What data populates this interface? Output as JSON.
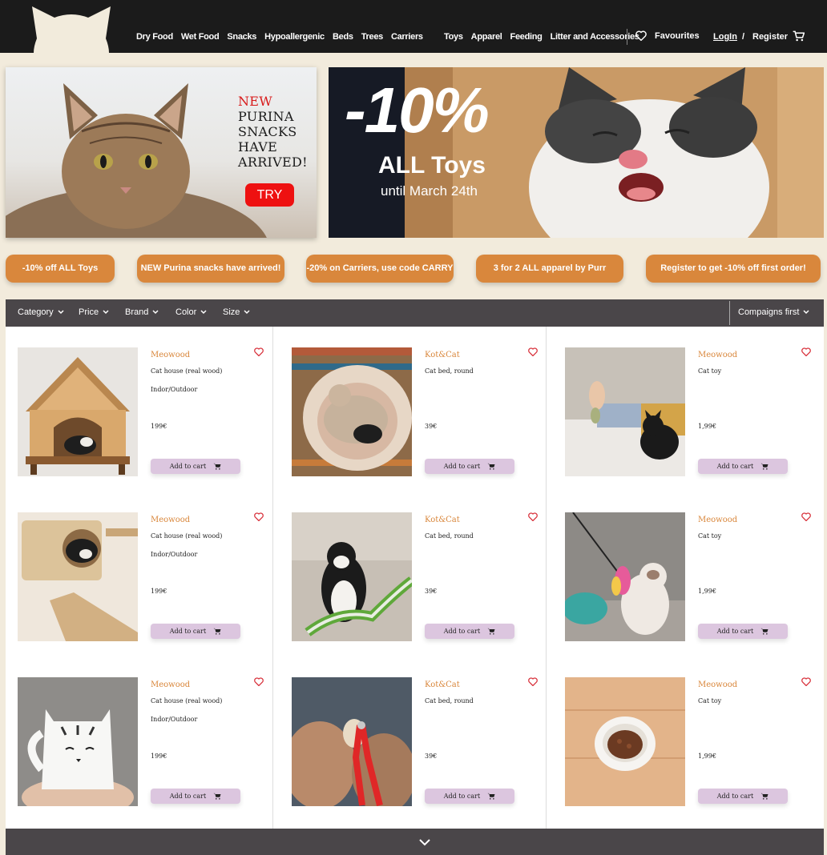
{
  "header": {
    "nav_food": [
      "Dry Food",
      "Wet Food",
      "Snacks",
      "Hypoallergenic"
    ],
    "nav_furniture": [
      "Beds",
      "Trees",
      "Carriers"
    ],
    "nav_other": [
      "Toys",
      "Apparel",
      "Feeding",
      "Litter and Accessories"
    ],
    "favourites_label": "Favourites",
    "login_label": "LogIn",
    "slash": "/",
    "register_label": "Register"
  },
  "banner_left": {
    "line1": "NEW",
    "line2": "PURINA",
    "line3": "SNACKS",
    "line4": "HAVE",
    "line5": "ARRIVED!",
    "button_label": "TRY"
  },
  "banner_right": {
    "discount": "-10%",
    "title": "ALL Toys",
    "subtitle": "until March 24th"
  },
  "promos": [
    "-10% off ALL Toys",
    "NEW Purina snacks have arrived!",
    "-20% on Carriers, use code CARRY",
    "3 for 2 ALL apparel by Purr",
    "Register to get -10% off first order!"
  ],
  "filters": {
    "items": [
      "Category",
      "Price",
      "Brand",
      "Color",
      "Size"
    ],
    "sort_label": "Compaigns first"
  },
  "products": [
    {
      "brand": "Meowood",
      "desc": "Cat house (real wood)",
      "desc2": "Indor/Outdoor",
      "price": "199€",
      "cart_label": "Add to cart"
    },
    {
      "brand": "Kot&Cat",
      "desc": "Cat bed, round",
      "desc2": "",
      "price": "39€",
      "cart_label": "Add to cart"
    },
    {
      "brand": "Meowood",
      "desc": "Cat toy",
      "desc2": "",
      "price": "1,99€",
      "cart_label": "Add to cart"
    },
    {
      "brand": "Meowood",
      "desc": "Cat house (real wood)",
      "desc2": "Indor/Outdoor",
      "price": "199€",
      "cart_label": "Add to cart"
    },
    {
      "brand": "Kot&Cat",
      "desc": "Cat bed, round",
      "desc2": "",
      "price": "39€",
      "cart_label": "Add to cart"
    },
    {
      "brand": "Meowood",
      "desc": "Cat toy",
      "desc2": "",
      "price": "1,99€",
      "cart_label": "Add to cart"
    },
    {
      "brand": "Meowood",
      "desc": "Cat house (real wood)",
      "desc2": "Indor/Outdoor",
      "price": "199€",
      "cart_label": "Add to cart"
    },
    {
      "brand": "Kot&Cat",
      "desc": "Cat bed, round",
      "desc2": "",
      "price": "39€",
      "cart_label": "Add to cart"
    },
    {
      "brand": "Meowood",
      "desc": "Cat toy",
      "desc2": "",
      "price": "1,99€",
      "cart_label": "Add to cart"
    }
  ],
  "colors": {
    "header_bg": "#1b1b1b",
    "page_bg": "#f2ebdc",
    "accent_orange": "#d9873c",
    "filter_bar": "#4a4649",
    "cart_button": "#dcc6df",
    "heart": "#d8323c",
    "try_button": "#ee1111"
  }
}
